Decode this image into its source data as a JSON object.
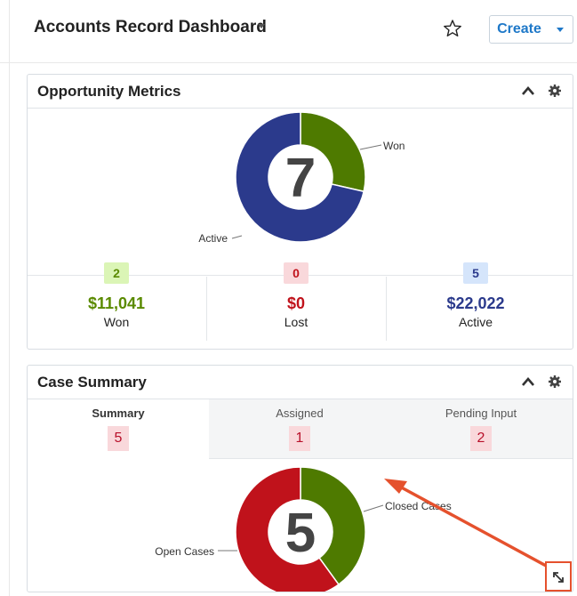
{
  "header": {
    "title": "Accounts Record Dashboard",
    "create_label": "Create"
  },
  "opportunity": {
    "title": "Opportunity Metrics",
    "total": "7",
    "labels": {
      "won": "Won",
      "active": "Active"
    },
    "metrics": [
      {
        "count": "2",
        "amount": "$11,041",
        "label": "Won",
        "color": "#5a8a00",
        "badge_bg": "#dbf5b6"
      },
      {
        "count": "0",
        "amount": "$0",
        "label": "Lost",
        "color": "#c0121b",
        "badge_bg": "#f9d8db"
      },
      {
        "count": "5",
        "amount": "$22,022",
        "label": "Active",
        "color": "#2b3a8c",
        "badge_bg": "#d5e5fb"
      }
    ],
    "chart_data": {
      "type": "pie",
      "categories": [
        "Won",
        "Active"
      ],
      "values": [
        2,
        5
      ],
      "colors": [
        "#4e7a00",
        "#2b3a8c"
      ],
      "center_label": "7"
    }
  },
  "cases": {
    "title": "Case Summary",
    "tabs": [
      {
        "label": "Summary",
        "count": "5"
      },
      {
        "label": "Assigned",
        "count": "1"
      },
      {
        "label": "Pending Input",
        "count": "2"
      }
    ],
    "total": "5",
    "labels": {
      "closed": "Closed Cases",
      "open": "Open Cases"
    },
    "chart_data": {
      "type": "pie",
      "categories": [
        "Closed Cases",
        "Open Cases"
      ],
      "values": [
        2,
        3
      ],
      "colors": [
        "#4e7a00",
        "#c0121b"
      ],
      "center_label": "5"
    }
  },
  "colors": {
    "accent": "#1e78c8",
    "annotation": "#e5512d"
  }
}
